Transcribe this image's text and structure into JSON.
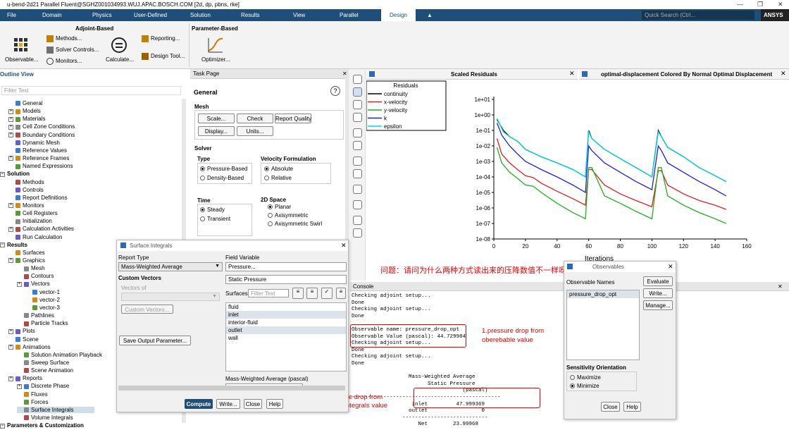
{
  "window": {
    "title": "u-bend-2d21 Parallel Fluent@SGHZ001034993.WUJ.APAC.BOSCH.COM  [2d, dp, pbns, rke]"
  },
  "menu": [
    "File",
    "Domain",
    "Physics",
    "User-Defined",
    "Solution",
    "Results",
    "View",
    "Parallel",
    "Design"
  ],
  "active_menu": "Design",
  "quick_search": "Quick Search (Ctrl...",
  "brand": "ANSYS",
  "ribbon": {
    "adjoint_title": "Adjoint-Based",
    "observable": "Observable...",
    "methods": "Methods...",
    "solver_controls": "Solver Controls...",
    "monitors": "Monitors...",
    "calculate": "Calculate...",
    "reporting": "Reporting...",
    "design_tool": "Design Tool...",
    "param_title": "Parameter-Based",
    "optimizer": "Optimizer..."
  },
  "outline": {
    "title": "Outline View",
    "filter": "Filter Text",
    "items": [
      {
        "label": "General",
        "lvl": 1,
        "exp": false
      },
      {
        "label": "Models",
        "lvl": 1,
        "exp": true
      },
      {
        "label": "Materials",
        "lvl": 1,
        "exp": true
      },
      {
        "label": "Cell Zone Conditions",
        "lvl": 1,
        "exp": true
      },
      {
        "label": "Boundary Conditions",
        "lvl": 1,
        "exp": true
      },
      {
        "label": "Dynamic Mesh",
        "lvl": 1,
        "exp": false
      },
      {
        "label": "Reference Values",
        "lvl": 1,
        "exp": false
      },
      {
        "label": "Reference Frames",
        "lvl": 1,
        "exp": true
      },
      {
        "label": "Named Expressions",
        "lvl": 1,
        "exp": false
      },
      {
        "label": "Solution",
        "lvl": 0,
        "exp": true,
        "sec": true
      },
      {
        "label": "Methods",
        "lvl": 1,
        "exp": false
      },
      {
        "label": "Controls",
        "lvl": 1,
        "exp": false
      },
      {
        "label": "Report Definitions",
        "lvl": 1,
        "exp": false
      },
      {
        "label": "Monitors",
        "lvl": 1,
        "exp": true
      },
      {
        "label": "Cell Registers",
        "lvl": 1,
        "exp": false
      },
      {
        "label": "Initialization",
        "lvl": 1,
        "exp": false
      },
      {
        "label": "Calculation Activities",
        "lvl": 1,
        "exp": true
      },
      {
        "label": "Run Calculation",
        "lvl": 1,
        "exp": false
      },
      {
        "label": "Results",
        "lvl": 0,
        "exp": true,
        "sec": true
      },
      {
        "label": "Surfaces",
        "lvl": 1,
        "exp": false
      },
      {
        "label": "Graphics",
        "lvl": 1,
        "exp": true
      },
      {
        "label": "Mesh",
        "lvl": 2,
        "exp": false
      },
      {
        "label": "Contours",
        "lvl": 2,
        "exp": false
      },
      {
        "label": "Vectors",
        "lvl": 2,
        "exp": true
      },
      {
        "label": "vector-1",
        "lvl": 3,
        "exp": false
      },
      {
        "label": "vector-2",
        "lvl": 3,
        "exp": false
      },
      {
        "label": "vector-3",
        "lvl": 3,
        "exp": false
      },
      {
        "label": "Pathlines",
        "lvl": 2,
        "exp": false
      },
      {
        "label": "Particle Tracks",
        "lvl": 2,
        "exp": false
      },
      {
        "label": "Plots",
        "lvl": 1,
        "exp": true
      },
      {
        "label": "Scene",
        "lvl": 1,
        "exp": false
      },
      {
        "label": "Animations",
        "lvl": 1,
        "exp": true
      },
      {
        "label": "Solution Animation Playback",
        "lvl": 2,
        "exp": false
      },
      {
        "label": "Sweep Surface",
        "lvl": 2,
        "exp": false
      },
      {
        "label": "Scene Animation",
        "lvl": 2,
        "exp": false
      },
      {
        "label": "Reports",
        "lvl": 1,
        "exp": true
      },
      {
        "label": "Discrete Phase",
        "lvl": 2,
        "exp": true
      },
      {
        "label": "Fluxes",
        "lvl": 2,
        "exp": false
      },
      {
        "label": "Forces",
        "lvl": 2,
        "exp": false
      },
      {
        "label": "Surface Integrals",
        "lvl": 2,
        "exp": false,
        "sel": true
      },
      {
        "label": "Volume Integrals",
        "lvl": 2,
        "exp": false
      },
      {
        "label": "Parameters & Customization",
        "lvl": 0,
        "exp": true,
        "sec": true
      }
    ]
  },
  "task": {
    "title": "Task Page",
    "general": "General",
    "mesh": "Mesh",
    "scale": "Scale...",
    "check": "Check",
    "report_quality": "Report Quality",
    "display": "Display...",
    "units": "Units...",
    "solver": "Solver",
    "type": "Type",
    "pressure_based": "Pressure-Based",
    "density_based": "Density-Based",
    "velocity_formulation": "Velocity Formulation",
    "absolute": "Absolute",
    "relative": "Relative",
    "time": "Time",
    "steady": "Steady",
    "transient": "Transient",
    "space": "2D Space",
    "planar": "Planar",
    "axisymmetric": "Axisymmetric",
    "axi_swirl": "Axisymmetric Swirl"
  },
  "chart_tabs": {
    "residuals_tab": "Scaled Residuals",
    "contour_tab": "optimal-displacement Colored By Normal Optimal Displacement"
  },
  "chart_data": {
    "type": "line",
    "title": "Residuals",
    "xlabel": "Iterations",
    "ylabel": "",
    "log_y": true,
    "xlim": [
      0,
      160
    ],
    "ylim": [
      1e-08,
      100.0
    ],
    "x_ticks": [
      0,
      20,
      40,
      60,
      80,
      100,
      120,
      140,
      160
    ],
    "y_ticks": [
      "1e-08",
      "1e-07",
      "1e-06",
      "1e-05",
      "1e-04",
      "1e-03",
      "1e-02",
      "1e-01",
      "1e+00",
      "1e+01"
    ],
    "legend_position": "top-left",
    "series": [
      {
        "name": "continuity",
        "color": "#000000",
        "x": [
          2,
          6,
          10,
          15,
          20,
          30,
          40,
          50,
          58,
          60,
          62,
          70,
          80,
          90,
          100,
          104,
          106,
          110,
          120,
          130,
          140,
          147
        ],
        "y": [
          0.5,
          0.1,
          0.04,
          0.02,
          0.006,
          0.002,
          0.0008,
          0.0003,
          0.0001,
          0.1,
          0.03,
          0.006,
          0.0015,
          0.0004,
          0.0001,
          0.1,
          0.04,
          0.008,
          0.002,
          0.0004,
          0.00012,
          5e-05
        ]
      },
      {
        "name": "x-velocity",
        "color": "#e02020",
        "x": [
          2,
          5,
          10,
          15,
          20,
          25,
          30,
          40,
          50,
          58,
          60,
          62,
          70,
          80,
          90,
          100,
          104,
          106,
          110,
          120,
          130,
          140,
          147
        ],
        "y": [
          0.03,
          0.003,
          0.0008,
          0.0003,
          0.00012,
          9e-05,
          4e-05,
          1.2e-05,
          4e-06,
          1.5e-06,
          0.0003,
          0.0003,
          3e-05,
          8e-06,
          3e-06,
          1.2e-06,
          0.00025,
          0.00025,
          3e-05,
          8e-06,
          3e-06,
          1.5e-06,
          8e-07
        ]
      },
      {
        "name": "y-velocity",
        "color": "#20b020",
        "x": [
          2,
          5,
          10,
          15,
          20,
          25,
          30,
          40,
          50,
          58,
          60,
          62,
          70,
          80,
          90,
          100,
          104,
          106,
          110,
          120,
          130,
          140,
          147
        ],
        "y": [
          0.008,
          0.0008,
          0.0002,
          8e-05,
          3e-05,
          2.5e-05,
          1e-05,
          2e-06,
          5e-07,
          2e-07,
          0.0004,
          0.0004,
          6e-06,
          2e-06,
          6e-07,
          2e-07,
          0.0004,
          0.0004,
          6e-06,
          1.5e-06,
          5e-07,
          2e-07,
          1e-07
        ]
      },
      {
        "name": "k",
        "color": "#2020e0",
        "x": [
          2,
          5,
          10,
          15,
          20,
          30,
          40,
          50,
          58,
          60,
          62,
          70,
          80,
          90,
          100,
          104,
          106,
          110,
          120,
          130,
          140,
          147
        ],
        "y": [
          0.3,
          0.05,
          0.01,
          0.003,
          0.001,
          0.0003,
          0.0001,
          3e-05,
          1e-05,
          0.01,
          0.005,
          0.0008,
          0.0002,
          5e-05,
          1.5e-05,
          0.01,
          0.005,
          0.0008,
          0.0002,
          5e-05,
          1.5e-05,
          6e-06
        ]
      },
      {
        "name": "epsilon",
        "color": "#00d8e8",
        "x": [
          2,
          6,
          10,
          15,
          20,
          30,
          40,
          50,
          58,
          60,
          62,
          70,
          80,
          90,
          100,
          104,
          106,
          110,
          120,
          130,
          140,
          147
        ],
        "y": [
          0.6,
          0.08,
          0.04,
          0.02,
          0.006,
          0.002,
          0.0008,
          0.0003,
          0.0001,
          0.08,
          0.03,
          0.006,
          0.0015,
          0.0004,
          0.0001,
          0.08,
          0.04,
          0.008,
          0.002,
          0.0004,
          0.00012,
          5e-05
        ]
      }
    ]
  },
  "console": {
    "title": "Console",
    "lines": [
      "Checking adjoint setup...",
      "Done",
      "Checking adjoint setup...",
      "Done",
      "",
      "Observable name: pressure_drop_opt",
      "Observable Value (pascal): 44.729984",
      "Checking adjoint setup...",
      "Done",
      "Checking adjoint setup...",
      "Done",
      "",
      "                  Mass-Weighted Average",
      "                        Static Pressure",
      "                                   (pascal)",
      "-----------------------------------------------",
      "                   inlet         47.999369",
      "                  outlet                 0",
      "                ---------------------------",
      "                     Net        23.99968"
    ]
  },
  "annotations": {
    "question": "问题：请问为什么两种方式读出来的压降数值不一样呀？",
    "note1_line1": "1.pressure drop from",
    "note1_line2": "oberebable value",
    "note2_line1": "2.pressure drop from",
    "note2_line2": "surface integrals value"
  },
  "surface_integrals": {
    "title": "Surface Integrals",
    "report_type_label": "Report Type",
    "report_type": "Mass-Weighted Average",
    "custom_vectors": "Custom Vectors",
    "vectors_of": "Vectors of",
    "custom_vectors_btn": "Custom Vectors...",
    "save_output": "Save Output Parameter...",
    "field_variable_label": "Field Variable",
    "field_variable": "Pressure...",
    "field_sub": "Static Pressure",
    "surfaces_label": "Surfaces",
    "surfaces_filter": "Filter Text",
    "surfaces": [
      "fluid",
      "inlet",
      "interior-fluid",
      "outlet",
      "wall"
    ],
    "result_label": "Mass-Weighted Average (pascal)",
    "compute": "Compute",
    "write": "Write...",
    "close": "Close",
    "help": "Help"
  },
  "observables": {
    "title": "Observables",
    "names_label": "Observable Names",
    "names": [
      "pressure_drop_opt"
    ],
    "evaluate": "Evaluate",
    "write": "Write...",
    "manage": "Manage...",
    "sensitivity": "Sensitivity Orientation",
    "maximize": "Maximize",
    "minimize": "Minimize",
    "close": "Close",
    "help": "Help"
  }
}
